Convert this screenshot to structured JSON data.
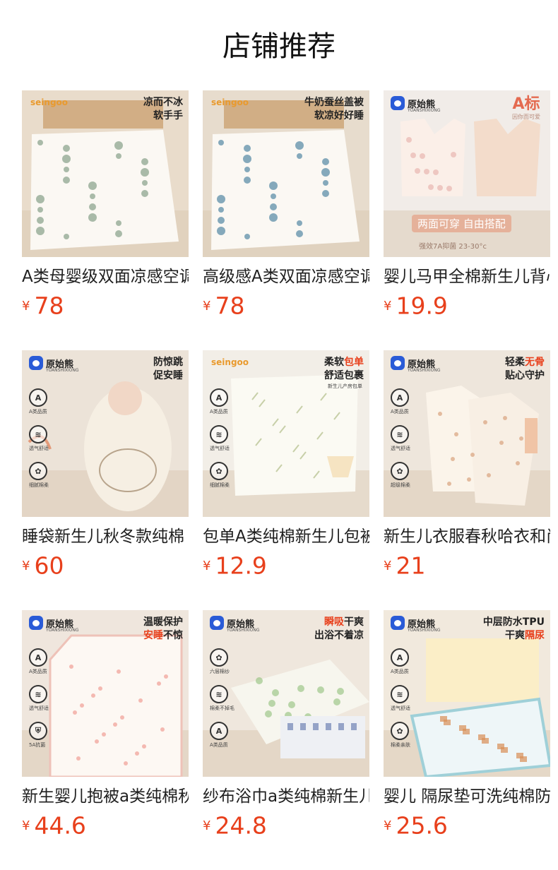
{
  "page": {
    "title": "店铺推荐"
  },
  "products": [
    {
      "name": "A类母婴级双面凉感空调被",
      "yen": "¥",
      "price": "78",
      "tagline": [
        "凉而不冰",
        "软手手"
      ],
      "brand": "",
      "logo": "seingoo",
      "bg": "#e9dccb",
      "accent": "#8ea58f",
      "icon": "blanket-illustration"
    },
    {
      "name": "高级感A类双面凉感空调被",
      "yen": "¥",
      "price": "78",
      "tagline": [
        "牛奶蚕丝盖被",
        "软凉好好睡"
      ],
      "brand": "",
      "logo": "seingoo",
      "bg": "#e7dccd",
      "accent": "#5d8fa8",
      "icon": "blanket-illustration"
    },
    {
      "name": "婴儿马甲全棉新生儿背心",
      "yen": "¥",
      "price": "19.9",
      "brand": "原始熊",
      "brand_sub": "YUANSHIXIONG",
      "a_mark": "A标",
      "a_mark_sub": "因你而可爱",
      "pill": "两面可穿  自由搭配",
      "note": "强效7A抑菌   23-30°c",
      "bg": "#f1ece8",
      "accent": "#e5b19a",
      "icon": "vest-illustration"
    },
    {
      "name": "睡袋新生儿秋冬款纯棉",
      "yen": "¥",
      "price": "60",
      "brand": "原始熊",
      "brand_sub": "YUANSHIXIONG",
      "tagline": [
        "防惊跳",
        "促安睡"
      ],
      "features": [
        {
          "glyph": "A",
          "label": "A类品质"
        },
        {
          "glyph": "≋",
          "label": "透气舒适"
        },
        {
          "glyph": "✿",
          "label": "细腻棉柔"
        }
      ],
      "bg": "#ece3d8",
      "accent": "#c9a98a",
      "icon": "sleeping-bag-illustration"
    },
    {
      "name": "包单A类纯棉新生儿包被",
      "yen": "¥",
      "price": "12.9",
      "logo": "seingoo",
      "tagline_parts": [
        [
          {
            "t": "柔软",
            "hl": false
          },
          {
            "t": "包单",
            "hl": true
          }
        ],
        [
          {
            "t": "舒适包裹",
            "hl": false
          }
        ]
      ],
      "sub_caption": "新生儿产房包单",
      "features": [
        {
          "glyph": "A",
          "label": "A类品质"
        },
        {
          "glyph": "≋",
          "label": "透气舒适"
        },
        {
          "glyph": "✿",
          "label": "细腻棉柔"
        }
      ],
      "bg": "#f2eee7",
      "accent": "#c7cfa8",
      "icon": "swaddle-illustration"
    },
    {
      "name": "新生儿衣服春秋哈衣和尚服",
      "yen": "¥",
      "price": "21",
      "brand": "原始熊",
      "brand_sub": "YUANSHIXIONG",
      "tagline_parts": [
        [
          {
            "t": "轻柔",
            "hl": false
          },
          {
            "t": "无骨",
            "hl": true
          }
        ],
        [
          {
            "t": "贴心守护",
            "hl": false
          }
        ]
      ],
      "features": [
        {
          "glyph": "A",
          "label": "A类品质"
        },
        {
          "glyph": "≋",
          "label": "透气舒适"
        },
        {
          "glyph": "✿",
          "label": "超级棉柔"
        }
      ],
      "bg": "#eee6dc",
      "accent": "#f0c4a6",
      "icon": "romper-illustration"
    },
    {
      "name": "新生婴儿抱被a类纯棉秋冬",
      "yen": "¥",
      "price": "44.6",
      "brand": "原始熊",
      "brand_sub": "YUANSHIXIONG",
      "tagline_parts": [
        [
          {
            "t": "温暖保护",
            "hl": false
          }
        ],
        [
          {
            "t": "安睡",
            "hl": true
          },
          {
            "t": "不惊",
            "hl": false
          }
        ]
      ],
      "features": [
        {
          "glyph": "A",
          "label": "A类品质"
        },
        {
          "glyph": "≋",
          "label": "透气舒适"
        },
        {
          "glyph": "⛨",
          "label": "5A抗菌"
        }
      ],
      "bg": "#efe6dd",
      "accent": "#f1a9a0",
      "icon": "hooded-blanket-illustration"
    },
    {
      "name": "纱布浴巾a类纯棉新生儿",
      "yen": "¥",
      "price": "24.8",
      "brand": "原始熊",
      "brand_sub": "YUANSHIXIONG",
      "tagline_parts": [
        [
          {
            "t": "瞬吸",
            "hl": true
          },
          {
            "t": "干爽",
            "hl": false
          }
        ],
        [
          {
            "t": "出浴不着凉",
            "hl": false
          }
        ]
      ],
      "features": [
        {
          "glyph": "✿",
          "label": "六层棉纱"
        },
        {
          "glyph": "≋",
          "label": "棉柔不掉毛"
        },
        {
          "glyph": "A",
          "label": "A类品质"
        }
      ],
      "bg": "#efe7dd",
      "accent": "#8fbf7a",
      "icon": "towel-stack-illustration"
    },
    {
      "name": "婴儿 隔尿垫可洗纯棉防水",
      "yen": "¥",
      "price": "25.6",
      "brand": "原始熊",
      "brand_sub": "YUANSHIXIONG",
      "tagline_parts": [
        [
          {
            "t": "中层防水TPU",
            "hl": false
          }
        ],
        [
          {
            "t": "干爽",
            "hl": false
          },
          {
            "t": "隔尿",
            "hl": true
          }
        ]
      ],
      "features": [
        {
          "glyph": "A",
          "label": "A类品质"
        },
        {
          "glyph": "≋",
          "label": "透气舒适"
        },
        {
          "glyph": "✿",
          "label": "棉柔亲肤"
        }
      ],
      "bg": "#f1e9dd",
      "accent": "#9fd0d8",
      "icon": "changing-pad-illustration"
    }
  ]
}
